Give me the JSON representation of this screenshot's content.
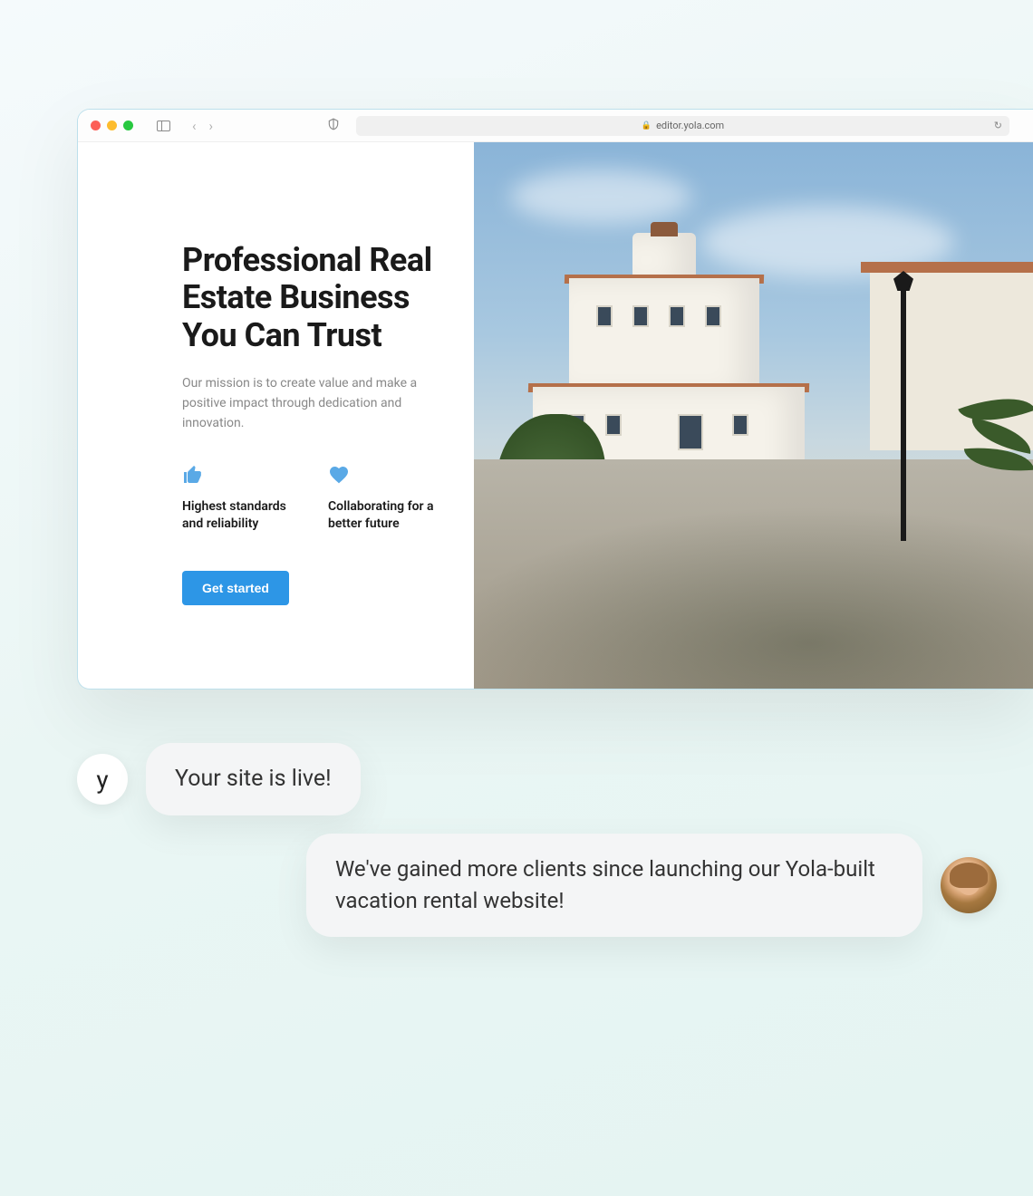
{
  "browser": {
    "url": "editor.yola.com"
  },
  "hero": {
    "headline": "Professional Real Estate Business You Can Trust",
    "mission": "Our mission is to create value and make a positive impact through dedication and innovation.",
    "features": [
      {
        "icon": "thumbs-up-icon",
        "text": "Highest standards and reliability"
      },
      {
        "icon": "heart-icon",
        "text": "Collaborating for a better future"
      }
    ],
    "cta_label": "Get started"
  },
  "chat": {
    "avatar_letter": "y",
    "message1": "Your site is live!",
    "message2": "We've gained more clients since launching our Yola-built vacation rental website!"
  }
}
